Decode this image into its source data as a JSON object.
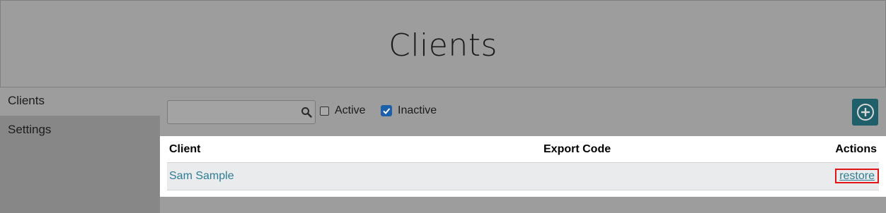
{
  "header": {
    "title": "Clients"
  },
  "sidebar": {
    "items": [
      {
        "label": "Clients",
        "active": true
      },
      {
        "label": "Settings",
        "active": false
      }
    ]
  },
  "toolbar": {
    "search": {
      "value": "",
      "placeholder": "",
      "icon": "search-icon"
    },
    "filters": [
      {
        "label": "Active",
        "checked": false
      },
      {
        "label": "Inactive",
        "checked": true
      }
    ],
    "add_button": {
      "icon": "plus-circle-icon",
      "color": "#1f5f6a"
    }
  },
  "table": {
    "columns": [
      "Client",
      "Export Code",
      "Actions"
    ],
    "rows": [
      {
        "client": "Sam Sample",
        "export_code": "",
        "action": "restore"
      }
    ]
  },
  "colors": {
    "accent": "#2e7d96",
    "highlight_box": "#e01515",
    "checkbox_checked": "#1d5fa8"
  }
}
